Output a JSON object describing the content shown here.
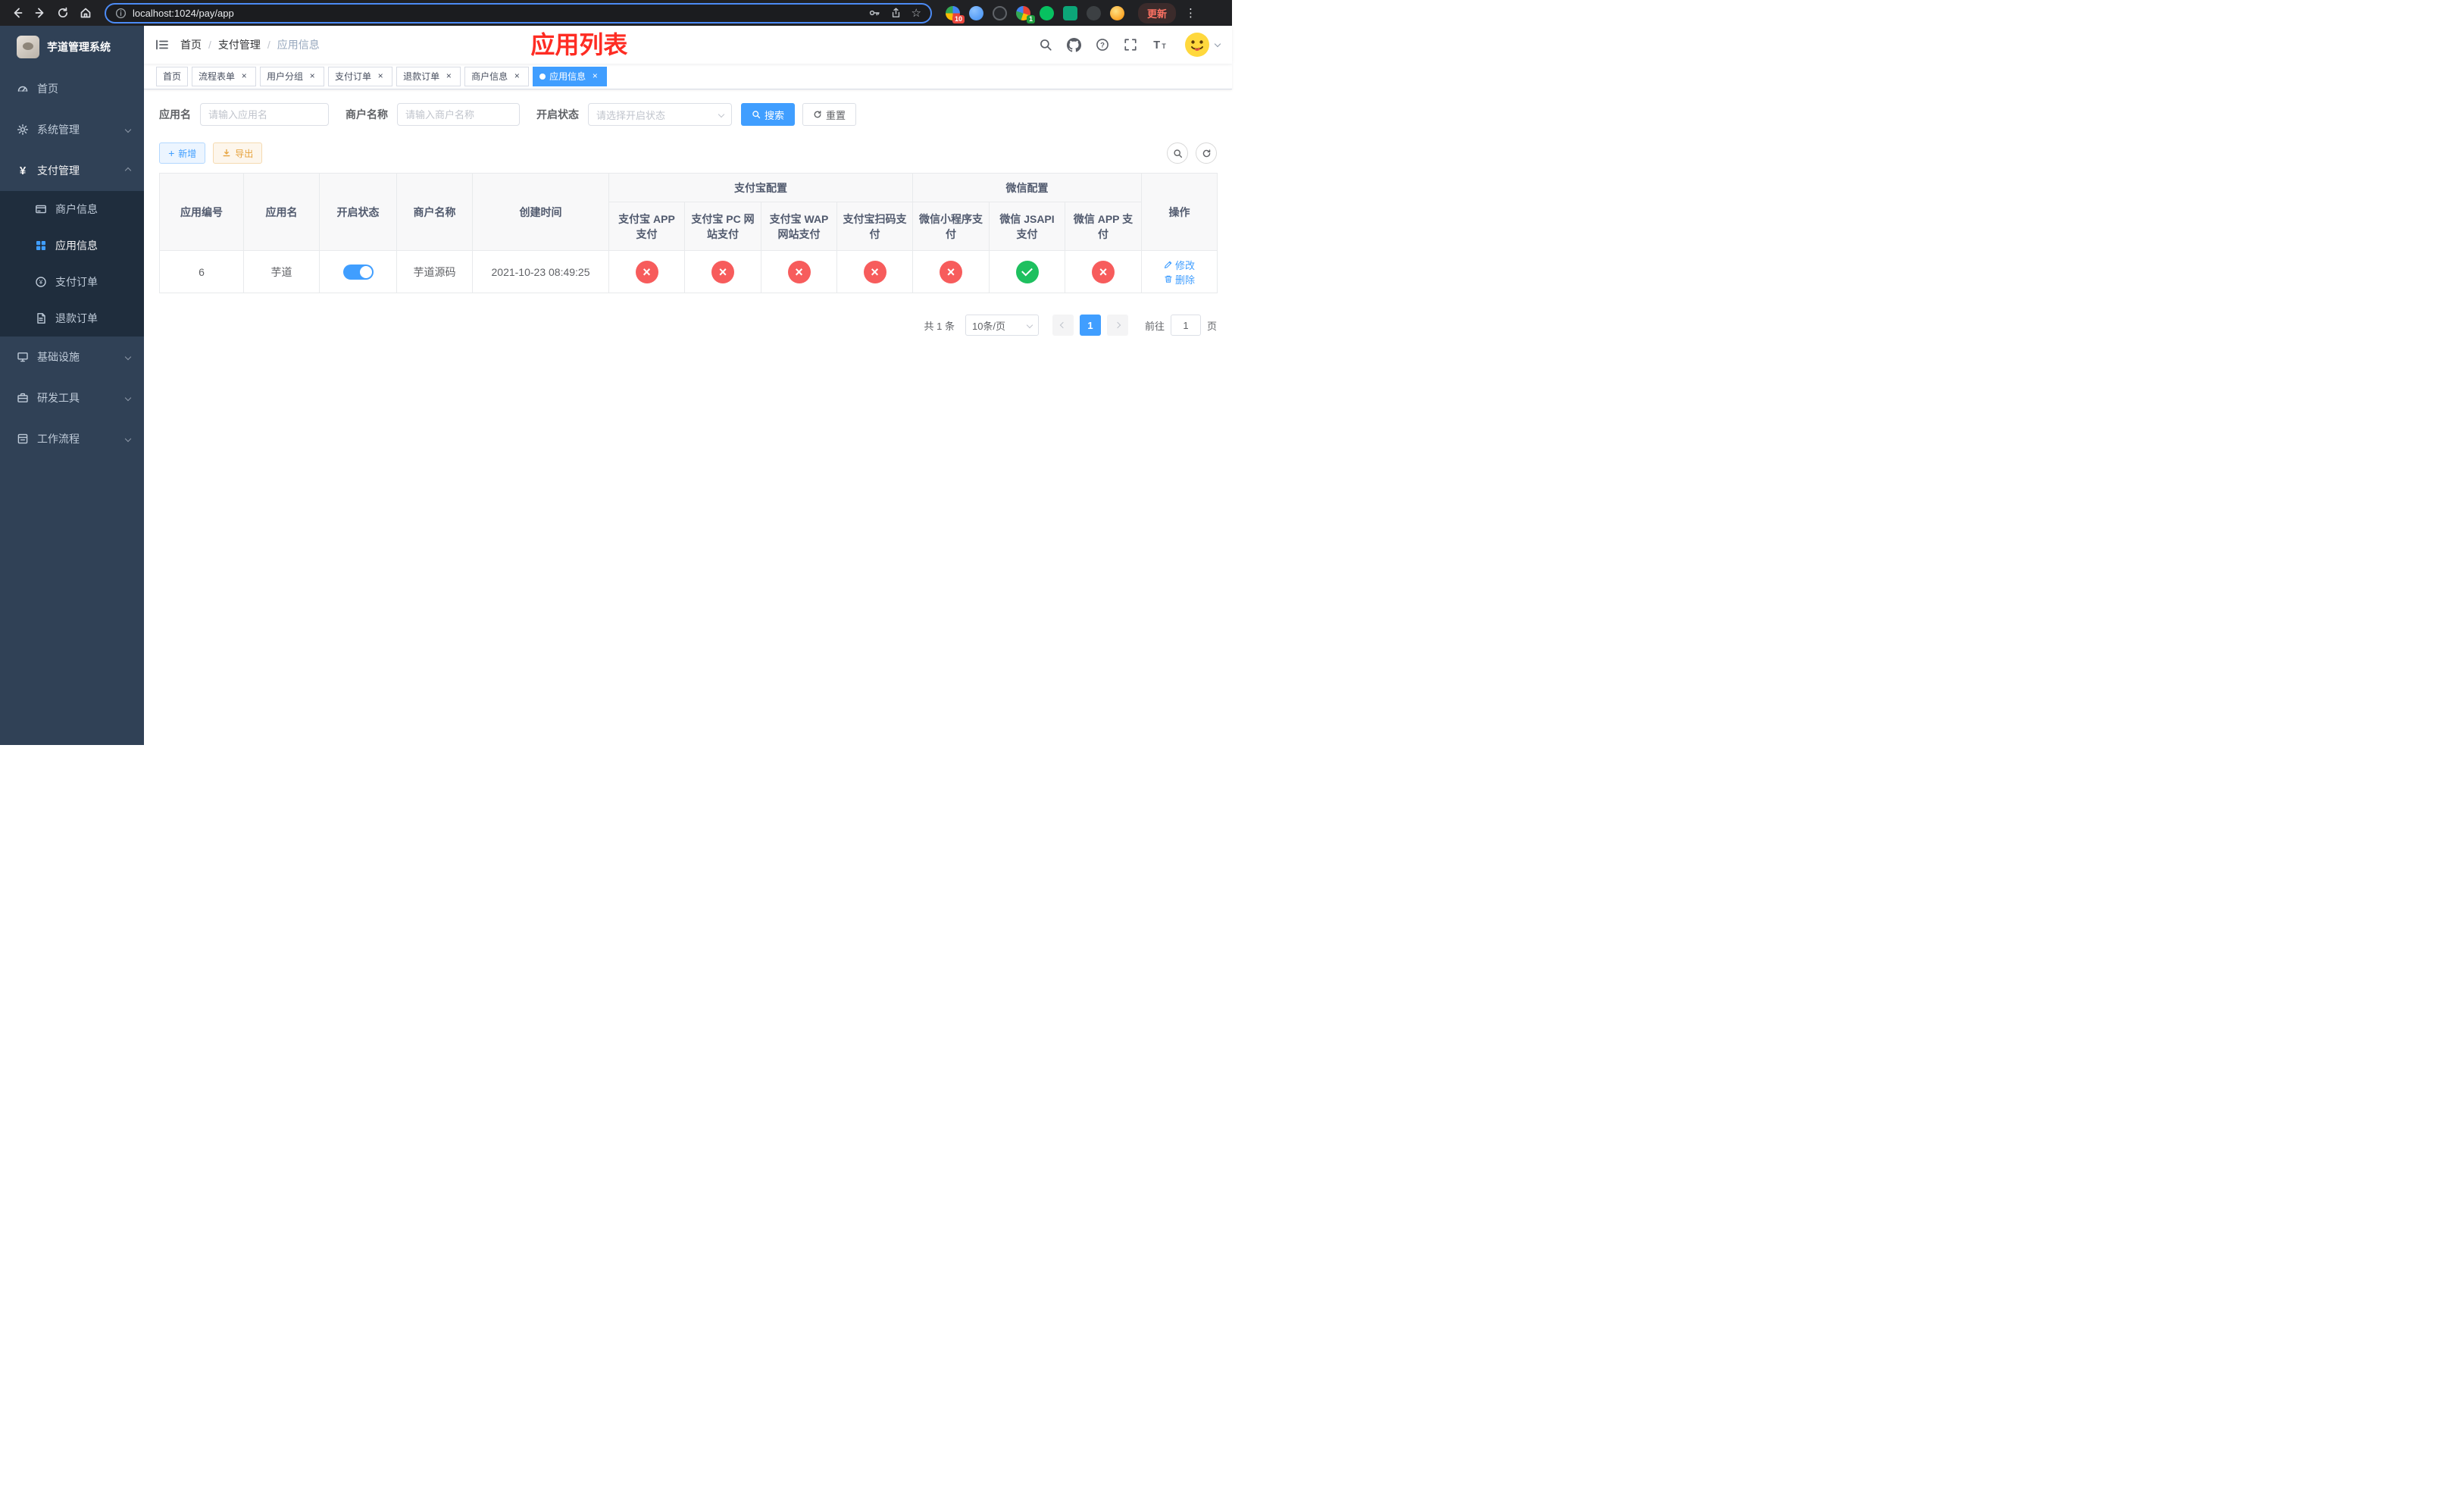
{
  "colors": {
    "primary": "#409eff",
    "danger": "#f75c5c",
    "success": "#1ec05f",
    "warning": "#e6a23c",
    "sidebar-bg": "#304156",
    "sidebar-sub-bg": "#1f2d3d",
    "annotation-red": "#fe2c23"
  },
  "browser": {
    "url": "localhost:1024/pay/app",
    "update_label": "更新",
    "badge_blue": "10",
    "badge_green": "1"
  },
  "sidebar": {
    "title": "芋道管理系统",
    "menu": {
      "home": "首页",
      "system": "系统管理",
      "pay": "支付管理",
      "merchant": "商户信息",
      "app": "应用信息",
      "order": "支付订单",
      "refund": "退款订单",
      "infra": "基础设施",
      "dev": "研发工具",
      "workflow": "工作流程"
    }
  },
  "navbar": {
    "breadcrumb_home": "首页",
    "breadcrumb_pay": "支付管理",
    "breadcrumb_current": "应用信息",
    "annotation_title": "应用列表"
  },
  "tags": {
    "home": "首页",
    "flow": "流程表单",
    "group": "用户分组",
    "order": "支付订单",
    "refund": "退款订单",
    "merchant": "商户信息",
    "app": "应用信息"
  },
  "filters": {
    "app_name_label": "应用名",
    "app_name_placeholder": "请输入应用名",
    "merchant_label": "商户名称",
    "merchant_placeholder": "请输入商户名称",
    "status_label": "开启状态",
    "status_placeholder": "请选择开启状态",
    "search_label": "搜索",
    "reset_label": "重置"
  },
  "toolbar": {
    "add_label": "新增",
    "export_label": "导出"
  },
  "table": {
    "columns": {
      "id": "应用编号",
      "name": "应用名",
      "status": "开启状态",
      "merchant": "商户名称",
      "created": "创建时间",
      "alipay_group": "支付宝配置",
      "alipay_app": "支付宝 APP 支付",
      "alipay_pc": "支付宝 PC 网站支付",
      "alipay_wap": "支付宝 WAP 网站支付",
      "alipay_qr": "支付宝扫码支付",
      "wechat_group": "微信配置",
      "wx_mini": "微信小程序支付",
      "wx_jsapi": "微信 JSAPI 支付",
      "wx_app": "微信 APP 支付",
      "actions": "操作"
    },
    "row": {
      "id": "6",
      "name": "芋道",
      "enabled": true,
      "merchant": "芋道源码",
      "created": "2021-10-23 08:49:25",
      "alipay_app": false,
      "alipay_pc": false,
      "alipay_wap": false,
      "alipay_qr": false,
      "wx_mini": false,
      "wx_jsapi": true,
      "wx_app": false,
      "edit_label": "修改",
      "delete_label": "删除"
    }
  },
  "pagination": {
    "total": "共 1 条",
    "page_size": "10条/页",
    "current_page": "1",
    "goto_label": "前往",
    "goto_value": "1",
    "unit_label": "页"
  }
}
